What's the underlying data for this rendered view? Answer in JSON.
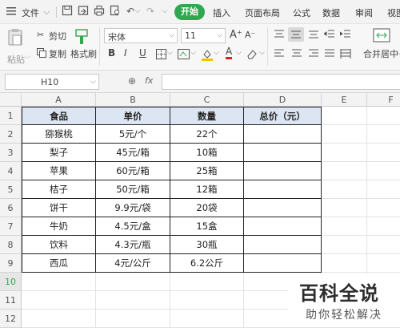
{
  "menubar": {
    "file_label": "文件",
    "tabs": [
      "开始",
      "插入",
      "页面布局",
      "公式",
      "数据",
      "审阅",
      "视图"
    ]
  },
  "ribbon": {
    "paste_label": "粘贴",
    "cut_label": "剪切",
    "copy_label": "复制",
    "format_painter_label": "格式刷",
    "font_name": "宋体",
    "font_size": "11",
    "merge_label": "合并居中",
    "bold": "B",
    "italic": "I",
    "underline": "U",
    "grow_font": "A⁺",
    "shrink_font": "A⁻",
    "font_color": "A"
  },
  "formula_bar": {
    "cell_ref": "H10",
    "fx": "fx",
    "value": ""
  },
  "sheet": {
    "columns": [
      "A",
      "B",
      "C",
      "D",
      "E",
      "F"
    ],
    "rows": [
      "1",
      "2",
      "3",
      "4",
      "5",
      "6",
      "7",
      "8",
      "9",
      "10",
      "11",
      "12"
    ],
    "selected_row": "10",
    "table": {
      "header": [
        "食品",
        "单价",
        "数量",
        "总价（元）"
      ],
      "body": [
        [
          "猕猴桃",
          "5元/个",
          "22个",
          ""
        ],
        [
          "梨子",
          "45元/箱",
          "10箱",
          ""
        ],
        [
          "苹果",
          "60元/箱",
          "25箱",
          ""
        ],
        [
          "桔子",
          "50元/箱",
          "12箱",
          ""
        ],
        [
          "饼干",
          "9.9元/袋",
          "20袋",
          ""
        ],
        [
          "牛奶",
          "4.5元/盒",
          "15盒",
          ""
        ],
        [
          "饮料",
          "4.3元/瓶",
          "30瓶",
          ""
        ],
        [
          "西瓜",
          "4元/公斤",
          "6.2公斤",
          ""
        ]
      ]
    },
    "header_fill": "#dce6f2",
    "accent": "#2fa84f"
  },
  "watermark": {
    "title": "百科全说",
    "subtitle": "助你轻松解决"
  }
}
